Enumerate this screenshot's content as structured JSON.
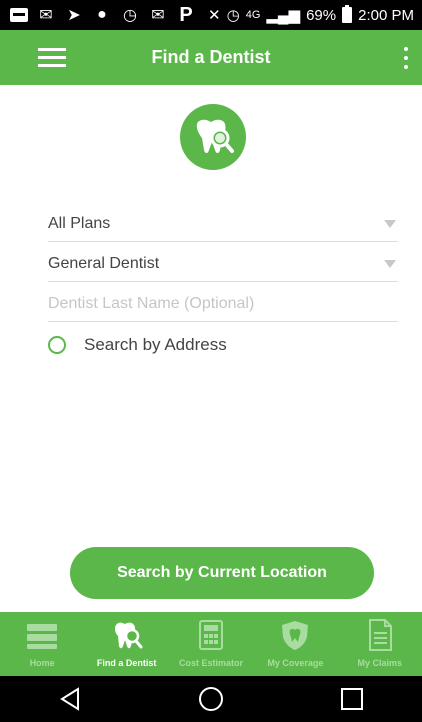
{
  "status_bar": {
    "battery_percent": "69%",
    "time": "2:00 PM",
    "network": "4G",
    "icons": [
      "message-icon",
      "email-icon",
      "send-icon",
      "location-icon",
      "alarm-icon",
      "gmail-icon",
      "pinterest-icon",
      "mute-icon",
      "alarm-icon",
      "signal-icon",
      "battery-icon"
    ]
  },
  "app_bar": {
    "title": "Find a Dentist",
    "menu_icon": "hamburger-menu-icon",
    "more_icon": "more-vert-icon"
  },
  "form": {
    "plan": {
      "value": "All Plans"
    },
    "specialty": {
      "value": "General Dentist"
    },
    "last_name": {
      "placeholder": "Dentist Last Name (Optional)"
    },
    "address_option": {
      "label": "Search by Address",
      "checked": false
    }
  },
  "search_button": {
    "label": "Search by Current Location"
  },
  "bottom_nav": {
    "items": [
      {
        "label": "Home",
        "icon": "home-icon",
        "active": false
      },
      {
        "label": "Find a Dentist",
        "icon": "tooth-search-icon",
        "active": true
      },
      {
        "label": "Cost Estimator",
        "icon": "calculator-icon",
        "active": false
      },
      {
        "label": "My Coverage",
        "icon": "shield-tooth-icon",
        "active": false
      },
      {
        "label": "My Claims",
        "icon": "document-icon",
        "active": false
      }
    ]
  },
  "colors": {
    "brand_green": "#5cb74a",
    "inactive_nav_label": "#a8dca0",
    "status_bar_bg": "#000000"
  }
}
